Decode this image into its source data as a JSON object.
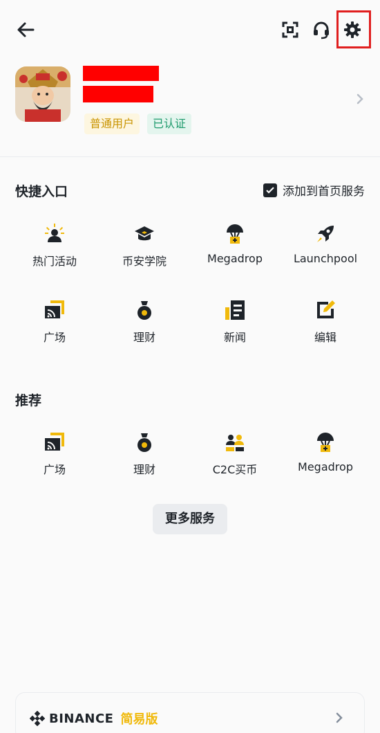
{
  "profile": {
    "badge_user": "普通用户",
    "badge_verified": "已认证"
  },
  "quick": {
    "title": "快捷入口",
    "add_home_label": "添加到首页服务",
    "add_home_checked": true,
    "items": [
      {
        "label": "热门活动",
        "icon": "hot-activity-icon"
      },
      {
        "label": "币安学院",
        "icon": "academy-icon"
      },
      {
        "label": "Megadrop",
        "icon": "megadrop-icon"
      },
      {
        "label": "Launchpool",
        "icon": "launchpool-icon"
      },
      {
        "label": "广场",
        "icon": "square-icon"
      },
      {
        "label": "理财",
        "icon": "earn-icon"
      },
      {
        "label": "新闻",
        "icon": "news-icon"
      },
      {
        "label": "编辑",
        "icon": "edit-icon"
      }
    ]
  },
  "recommend": {
    "title": "推荐",
    "items": [
      {
        "label": "广场",
        "icon": "square-icon"
      },
      {
        "label": "理财",
        "icon": "earn-icon"
      },
      {
        "label": "C2C买币",
        "icon": "c2c-icon"
      },
      {
        "label": "Megadrop",
        "icon": "megadrop-icon"
      }
    ]
  },
  "more_services_label": "更多服务",
  "lite": {
    "brand": "BINANCE",
    "label": "简易版"
  },
  "colors": {
    "accent": "#f0b90b",
    "dark": "#1e2329",
    "highlight_box": "#e01e1e"
  }
}
